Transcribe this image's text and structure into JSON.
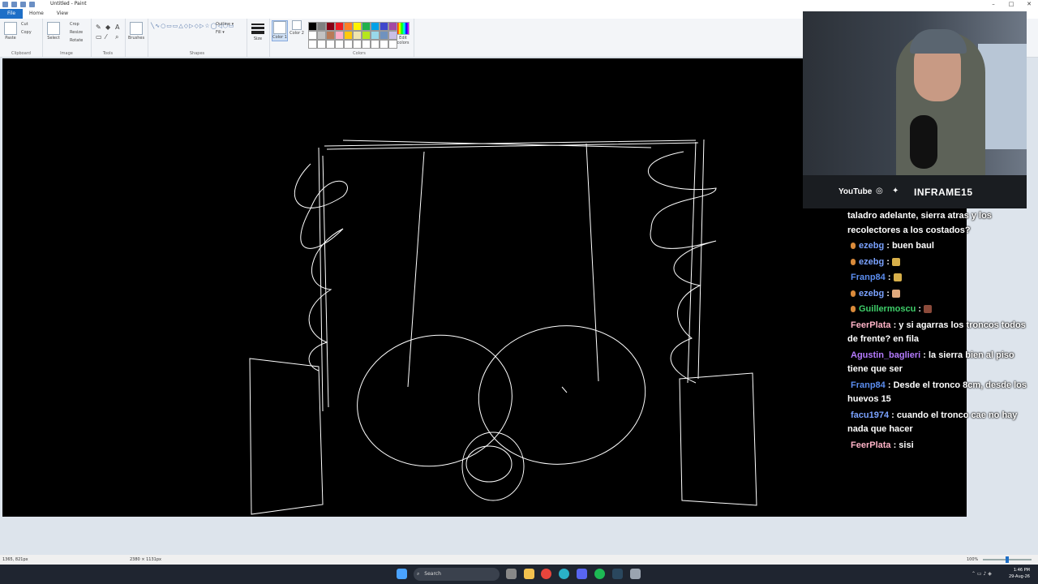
{
  "window": {
    "title": "Untitled - Paint",
    "minimize": "–",
    "maximize": "□",
    "close": "✕"
  },
  "menu": {
    "file": "File",
    "home": "Home",
    "view": "View"
  },
  "ribbon": {
    "clipboard": {
      "paste": "Paste",
      "cut": "Cut",
      "copy": "Copy",
      "label": "Clipboard"
    },
    "image": {
      "select": "Select",
      "crop": "Crop",
      "resize": "Resize",
      "rotate": "Rotate",
      "label": "Image"
    },
    "tools": {
      "label": "Tools"
    },
    "brushes": {
      "label": "Brushes"
    },
    "shapes": {
      "outline": "Outline",
      "fill": "Fill",
      "label": "Shapes"
    },
    "size": {
      "label": "Size"
    },
    "color1": "Color 1",
    "color2": "Color 2",
    "colors": {
      "label": "Colors",
      "edit": "Edit colors"
    },
    "palette_row1": [
      "#000000",
      "#7f7f7f",
      "#880015",
      "#ed1c24",
      "#ff7f27",
      "#fff200",
      "#22b14c",
      "#00a2e8",
      "#3f48cc",
      "#a349a4"
    ],
    "palette_row2": [
      "#ffffff",
      "#c3c3c3",
      "#b97a57",
      "#ffaec9",
      "#ffc90e",
      "#efe4b0",
      "#b5e61d",
      "#99d9ea",
      "#7092be",
      "#c8bfe7"
    ]
  },
  "overlay": {
    "youtube": "YouTube",
    "channel": "INFRAME15"
  },
  "chat": [
    {
      "user": "",
      "user_color": "#ffffff",
      "text": "taladro adelante, sierra atras y los recolectores a los costados?",
      "badge": false
    },
    {
      "user": "ezebg",
      "user_color": "#7aa2ff",
      "text": " : buen baul",
      "badge": true
    },
    {
      "user": "ezebg",
      "user_color": "#7aa2ff",
      "text": " : ",
      "badge": true,
      "emote": "#d8b04a"
    },
    {
      "user": "Franp84",
      "user_color": "#5b8def",
      "text": " : ",
      "badge": false,
      "emote": "#d8b04a"
    },
    {
      "user": "ezebg",
      "user_color": "#7aa2ff",
      "text": " : ",
      "badge": true,
      "emote": "#e0a97c"
    },
    {
      "user": "Guillermoscu",
      "user_color": "#3fcf6a",
      "text": " : ",
      "badge": true,
      "emote": "#8b4a3a"
    },
    {
      "user": "FeerPlata",
      "user_color": "#ffb3c7",
      "text": " : y si agarras los troncos todos de frente? en fila",
      "badge": false
    },
    {
      "user": "Agustin_baglieri",
      "user_color": "#b57bff",
      "text": " : la sierra bien al piso tiene que ser",
      "badge": false
    },
    {
      "user": "Franp84",
      "user_color": "#5b8def",
      "text": " : Desde el tronco 8cm, desde los huevos 15",
      "badge": false
    },
    {
      "user": "facu1974",
      "user_color": "#7aa2ff",
      "text": " : cuando el tronco cae no hay nada que hacer",
      "badge": false
    },
    {
      "user": "FeerPlata",
      "user_color": "#ffb3c7",
      "text": " : sisi",
      "badge": false
    }
  ],
  "status": {
    "coords": "1365, 821px",
    "size": "2380 × 1131px",
    "zoom": "100%"
  },
  "taskbar": {
    "search": "Search",
    "time": "1:46 PM",
    "date": "29-Aug-26"
  }
}
